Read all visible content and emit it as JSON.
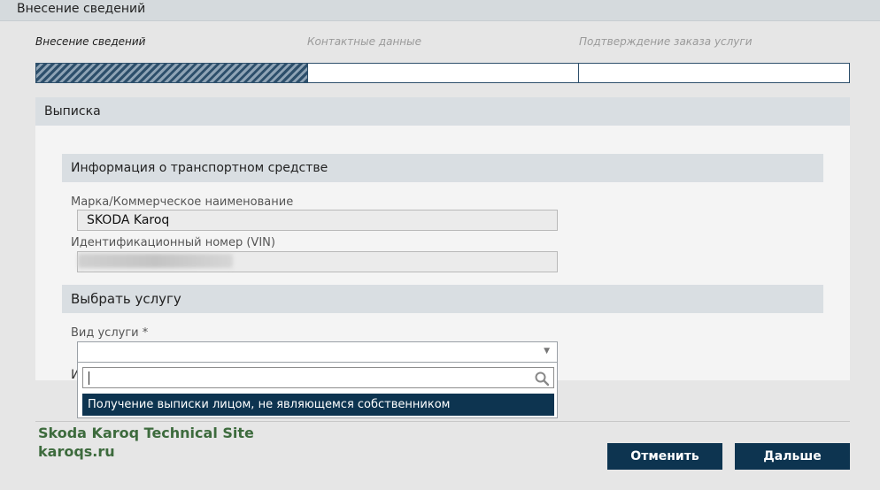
{
  "window": {
    "title": "Внесение сведений"
  },
  "steps": [
    {
      "label": "Внесение сведений",
      "state": "active"
    },
    {
      "label": "Контактные данные",
      "state": "inactive"
    },
    {
      "label": "Подтверждение заказа услуги",
      "state": "inactive"
    }
  ],
  "sections": {
    "main": "Выписка",
    "vehicle": "Информация о транспортном средстве",
    "service": "Выбрать услугу"
  },
  "vehicle": {
    "brand_label": "Марка/Коммерческое наименование",
    "brand_value": "SKODA Karoq",
    "vin_label": "Идентификационный номер (VIN)"
  },
  "service": {
    "type_label": "Вид услуги *",
    "hidden_field_letter": "И",
    "dropdown_search_value": "",
    "options": [
      "Получение выписки лицом, не являющемся собственником"
    ]
  },
  "watermark": {
    "line1": "Skoda Karoq Technical Site",
    "line2": "karoqs.ru"
  },
  "buttons": {
    "cancel": "Отменить",
    "next": "Дальше"
  },
  "colors": {
    "accent": "#0d3450",
    "section_bg": "#d9dee2",
    "watermark": "#3d6b3d"
  },
  "icons": {
    "search": "search-icon",
    "dropdown": "chevron-down-icon"
  }
}
